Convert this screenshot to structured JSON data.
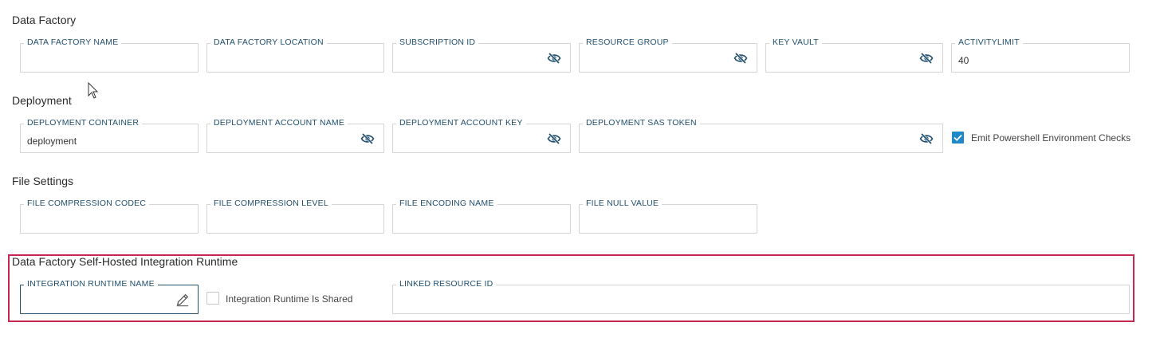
{
  "sections": {
    "data_factory": {
      "title": "Data Factory",
      "fields": {
        "name": {
          "label": "DATA FACTORY NAME",
          "value": ""
        },
        "location": {
          "label": "DATA FACTORY LOCATION",
          "value": ""
        },
        "subscription": {
          "label": "SUBSCRIPTION ID",
          "value": "",
          "icon": "eye-slash-icon"
        },
        "resource_group": {
          "label": "RESOURCE GROUP",
          "value": "",
          "icon": "eye-slash-icon"
        },
        "key_vault": {
          "label": "KEY VAULT",
          "value": "",
          "icon": "eye-slash-icon"
        },
        "activity_limit": {
          "label": "ACTIVITYLIMIT",
          "value": "40"
        }
      }
    },
    "deployment": {
      "title": "Deployment",
      "fields": {
        "container": {
          "label": "DEPLOYMENT CONTAINER",
          "value": "deployment"
        },
        "account_name": {
          "label": "DEPLOYMENT ACCOUNT NAME",
          "value": "",
          "icon": "eye-slash-icon"
        },
        "account_key": {
          "label": "DEPLOYMENT ACCOUNT KEY",
          "value": "",
          "icon": "eye-slash-icon"
        },
        "sas_token": {
          "label": "DEPLOYMENT SAS TOKEN",
          "value": "",
          "icon": "eye-slash-icon"
        }
      },
      "emit_checks": {
        "label": "Emit Powershell Environment Checks",
        "checked": true
      }
    },
    "file_settings": {
      "title": "File Settings",
      "fields": {
        "compression_codec": {
          "label": "FILE COMPRESSION CODEC",
          "value": ""
        },
        "compression_level": {
          "label": "FILE COMPRESSION LEVEL",
          "value": ""
        },
        "encoding_name": {
          "label": "FILE ENCODING NAME",
          "value": ""
        },
        "null_value": {
          "label": "FILE NULL VALUE",
          "value": ""
        }
      }
    },
    "integration_runtime": {
      "title": "Data Factory Self-Hosted Integration Runtime",
      "fields": {
        "runtime_name": {
          "label": "INTEGRATION RUNTIME NAME",
          "value": "",
          "icon": "pencil-icon",
          "focused": true
        },
        "linked_resource": {
          "label": "LINKED RESOURCE ID",
          "value": ""
        }
      },
      "is_shared": {
        "label": "Integration Runtime Is Shared",
        "checked": false
      }
    }
  },
  "colors": {
    "label": "#1f4e6e",
    "accent": "#1e88c8",
    "highlight_border": "#c8254f",
    "field_border": "#d4d4d4"
  }
}
